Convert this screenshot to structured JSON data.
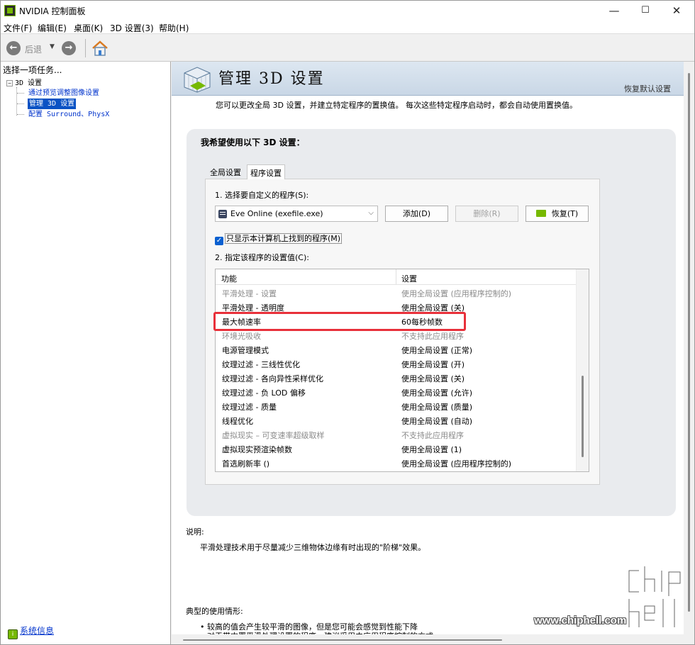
{
  "window": {
    "title": "NVIDIA 控制面板",
    "controls": {
      "minimize": "—",
      "maximize": "☐",
      "close": "✕"
    }
  },
  "menu": [
    "文件(F)",
    "编辑(E)",
    "桌面(K)",
    "3D 设置(3)",
    "帮助(H)"
  ],
  "toolbar": {
    "back_label": "后退",
    "back_icon": "back-arrow-icon",
    "forward_icon": "forward-arrow-icon",
    "home_icon": "home-icon"
  },
  "sidebar": {
    "header": "选择一项任务...",
    "tree": {
      "root": "3D 设置",
      "items": [
        "通过预览调整图像设置",
        "管理 3D 设置",
        "配置 Surround、PhysX"
      ],
      "selected_index": 1
    },
    "system_info": "系统信息"
  },
  "main": {
    "title": "管理 3D 设置",
    "restore_defaults": "恢复默认设置",
    "description": "您可以更改全局 3D 设置，并建立特定程序的置换值。 每次这些特定程序启动时，都会自动使用置换值。",
    "group_title": "我希望使用以下 3D 设置：",
    "tabs": [
      "全局设置",
      "程序设置"
    ],
    "active_tab": 1,
    "step1_label": "1. 选择要自定义的程序(S):",
    "program_select": "Eve Online (exefile.exe)",
    "buttons": {
      "add": "添加(D)",
      "remove": "删除(R)",
      "restore": "恢复(T)"
    },
    "checkbox_label": "只显示本计算机上找到的程序(M)",
    "checkbox_checked": true,
    "step2_label": "2. 指定该程序的设置值(C):",
    "settings_table": {
      "headers": [
        "功能",
        "设置"
      ],
      "rows": [
        {
          "feature": "平滑处理 - 设置",
          "value": "使用全局设置 (应用程序控制的)",
          "dim": true
        },
        {
          "feature": "平滑处理 - 透明度",
          "value": "使用全局设置 (关)",
          "dim": false
        },
        {
          "feature": "最大帧速率",
          "value": "60每秒帧数",
          "dim": false
        },
        {
          "feature": "环境光吸收",
          "value": "不支持此应用程序",
          "dim": true
        },
        {
          "feature": "电源管理模式",
          "value": "使用全局设置 (正常)",
          "dim": false
        },
        {
          "feature": "纹理过滤 - 三线性优化",
          "value": "使用全局设置 (开)",
          "dim": false
        },
        {
          "feature": "纹理过滤 - 各向异性采样优化",
          "value": "使用全局设置 (关)",
          "dim": false
        },
        {
          "feature": "纹理过滤 - 负 LOD 偏移",
          "value": "使用全局设置 (允许)",
          "dim": false
        },
        {
          "feature": "纹理过滤 - 质量",
          "value": "使用全局设置 (质量)",
          "dim": false
        },
        {
          "feature": "线程优化",
          "value": "使用全局设置 (自动)",
          "dim": false
        },
        {
          "feature": "虚拟现实 – 可变速率超级取样",
          "value": "不支持此应用程序",
          "dim": true
        },
        {
          "feature": "虚拟现实预渲染帧数",
          "value": "使用全局设置 (1)",
          "dim": false
        },
        {
          "feature": "首选刷新率 ()",
          "value": "使用全局设置 (应用程序控制的)",
          "dim": false
        }
      ]
    },
    "explanation_head": "说明:",
    "explanation_text": "平滑处理技术用于尽量减少三维物体边缘有时出现的\"阶梯\"效果。",
    "usage_head": "典型的使用情形:",
    "usage_items": [
      "• 较高的值会产生较平滑的图像，但是您可能会感觉到性能下降",
      "• 对于带内置平滑处理设置的程序，建议采用由应用程序控制的方式"
    ]
  },
  "watermark": {
    "url": "www.chiphell.com",
    "logo": "chip-hell"
  },
  "colors": {
    "nvidia_green": "#76b900",
    "highlight": "#e8303a",
    "selection": "#0a52c4",
    "link": "#0033cc"
  }
}
